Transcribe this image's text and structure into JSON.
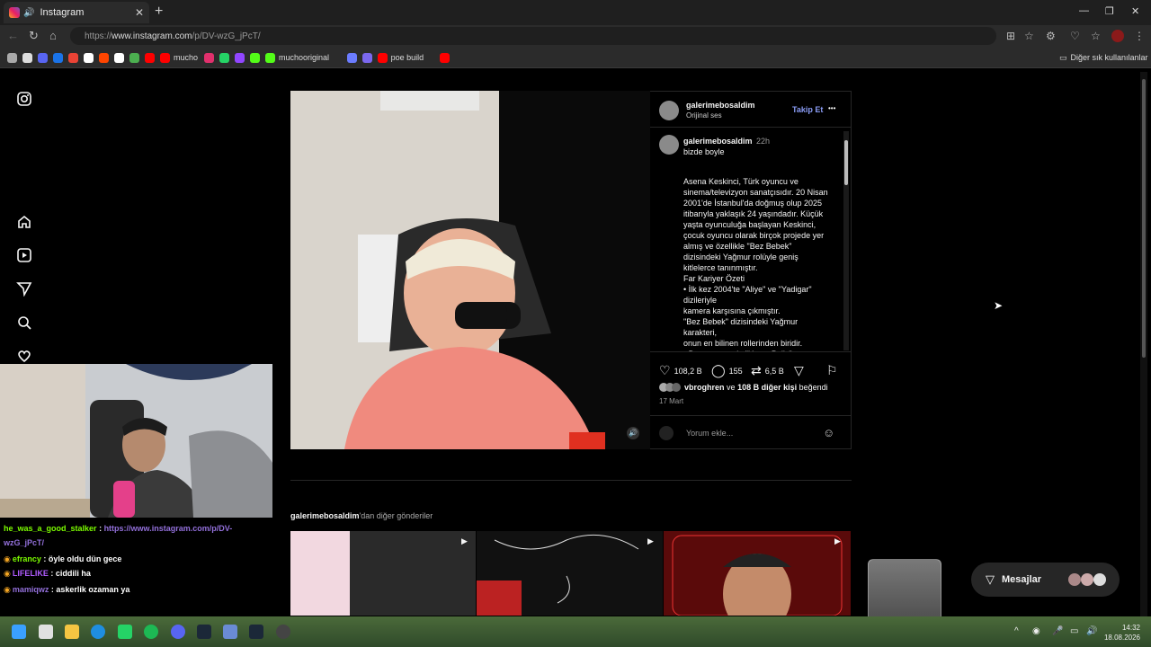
{
  "browser": {
    "tab_title": "Instagram",
    "url_prefix": "https://",
    "url_host": "www.instagram.com",
    "url_path": "/p/DV-wzG_jPcT/",
    "bookmarks": [
      {
        "label": "",
        "color": "#aaaaaa"
      },
      {
        "label": "",
        "color": "#dddddd"
      },
      {
        "label": "",
        "color": "#5865f2"
      },
      {
        "label": "",
        "color": "#1a73e8"
      },
      {
        "label": "",
        "color": "#ea4335"
      },
      {
        "label": "",
        "color": "#ffffff"
      },
      {
        "label": "",
        "color": "#ff4500"
      },
      {
        "label": "",
        "color": "#ffffff"
      },
      {
        "label": "",
        "color": "#4caf50"
      },
      {
        "label": "",
        "color": "#ff0000"
      },
      {
        "label": "mucho",
        "color": "#ff0000"
      },
      {
        "label": "",
        "color": "#e1306c"
      },
      {
        "label": "",
        "color": "#25d366"
      },
      {
        "label": "",
        "color": "#9146ff"
      },
      {
        "label": "",
        "color": "#53fc18"
      },
      {
        "label": "muchooriginal",
        "color": "#53fc18"
      },
      {
        "label": "",
        "color": "#6b7cff"
      },
      {
        "label": "",
        "color": "#7b68ee"
      },
      {
        "label": "poe build",
        "color": "#ff0000"
      },
      {
        "label": "",
        "color": "#ff0000"
      }
    ],
    "other_bookmarks": "Diğer sık kullanılanlar"
  },
  "post": {
    "username": "galerimebosaldim",
    "audio": "Orijinal ses",
    "follow": "Takip Et",
    "more": "•••",
    "caption_user": "galerimebosaldim",
    "caption_time": "22h",
    "caption_title": "bizde boyle",
    "caption_body": "Asena Keskinci, Türk oyuncu ve\nsinema/televizyon sanatçısıdır. 20 Nisan\n2001'de İstanbul'da doğmuş olup 2025\nitibarıyla yaklaşık 24 yaşındadır. Küçük\nyaşta oyunculuğa başlayan Keskinci,\nçocuk oyuncu olarak birçok projede yer\nalmış ve özellikle \"Bez Bebek\"\ndizisindeki Yağmur rolüyle geniş\nkitlelerce tanınmıştır.\nFar Kariyer Özeti\n• İlk kez 2004'te \"Aliye\" ve \"Yadigar\"\ndizileriyle\nkamera karşısına çıkmıştır.\n\"Bez Bebek\" dizisindeki Yağmur\nkarakteri,\nonun en bilinen rollerinden biridir.\n• Bunun yanında \"Hırsız Polis\",",
    "likes": "108,2 B",
    "comments": "155",
    "reposts": "6,5 B",
    "liked_by_user": "vbroghren",
    "liked_by_and": "ve",
    "liked_by_others": "108 B diğer kişi",
    "liked_by_suffix": "beğendi",
    "date": "17 Mart",
    "comment_placeholder": "Yorum ekle...",
    "more_posts_user": "galerimebosaldim",
    "more_posts_suffix": "'dan diğer gönderiler"
  },
  "chat": [
    {
      "user": "he_was_a_good_stalker",
      "sep": " : ",
      "text": "https://www.instagram.com/p/DV-",
      "user_color": "#7cfc00",
      "text_color": "#9370db"
    },
    {
      "user": "",
      "sep": "",
      "text": "wzG_jPcT/",
      "user_color": "#7cfc00",
      "text_color": "#9370db"
    },
    {
      "user": "efrancy",
      "sep": " : ",
      "text": "öyle oldu dün gece",
      "user_color": "#7cfc00",
      "text_color": "#ffffff"
    },
    {
      "user": "LIFELIKE",
      "sep": " : ",
      "text": "ciddili ha",
      "user_color": "#b05cff",
      "text_color": "#ffffff"
    },
    {
      "user": "mamiqwz",
      "sep": " : ",
      "text": "askerlik ozaman ya",
      "user_color": "#9370db",
      "text_color": "#ffffff"
    }
  ],
  "messages": {
    "label": "Mesajlar"
  },
  "taskbar": {
    "time": "14:32",
    "date": "18.08.2026"
  }
}
